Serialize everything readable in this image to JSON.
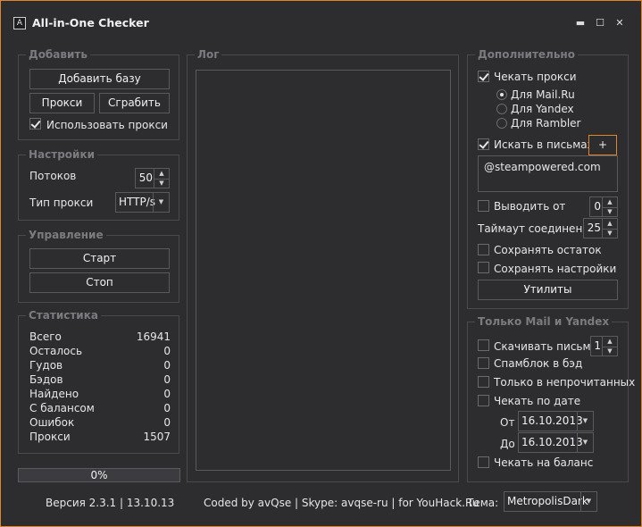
{
  "app": {
    "icon_letter": "A",
    "title": "All-in-One Checker"
  },
  "window_controls": {
    "minimize": "▬",
    "maximize": "☐",
    "close": "✕"
  },
  "add_group": {
    "title": "Добавить",
    "add_base": "Добавить базу",
    "proxy": "Прокси",
    "grab": "Сграбить",
    "use_proxy": {
      "label": "Использовать прокси",
      "checked": true
    }
  },
  "settings_group": {
    "title": "Настройки",
    "threads_label": "Потоков",
    "threads_value": "50",
    "proxy_type_label": "Тип прокси",
    "proxy_type_value": "HTTP/s"
  },
  "control_group": {
    "title": "Управление",
    "start": "Старт",
    "stop": "Стоп"
  },
  "stats_group": {
    "title": "Статистика",
    "rows": [
      {
        "label": "Всего",
        "value": "16941"
      },
      {
        "label": "Осталось",
        "value": "0"
      },
      {
        "label": "Гудов",
        "value": "0"
      },
      {
        "label": "Бэдов",
        "value": "0"
      },
      {
        "label": "Найдено",
        "value": "0"
      },
      {
        "label": "С балансом",
        "value": "0"
      },
      {
        "label": "Ошибок",
        "value": "0"
      },
      {
        "label": "Прокси",
        "value": "1507"
      }
    ]
  },
  "progress": {
    "text": "0%",
    "fraction": 0
  },
  "log_group": {
    "title": "Лог"
  },
  "extra_group": {
    "title": "Дополнительно",
    "check_proxy": {
      "label": "Чекать прокси",
      "checked": true
    },
    "radios": [
      {
        "label": "Для Mail.Ru",
        "selected": true
      },
      {
        "label": "Для Yandex",
        "selected": false
      },
      {
        "label": "Для Rambler",
        "selected": false
      }
    ],
    "search_in_letters": {
      "label": "Искать в письмах",
      "checked": true
    },
    "plus_button": "+",
    "search_text": "@steampowered.com",
    "output_from": {
      "label": "Выводить от",
      "checked": false,
      "value": "0"
    },
    "timeout_label": "Таймаут соединения",
    "timeout_value": "25",
    "save_rest": {
      "label": "Сохранять остаток",
      "checked": false
    },
    "save_settings": {
      "label": "Сохранять настройки",
      "checked": false
    },
    "utilities": "Утилиты"
  },
  "mailyandex_group": {
    "title": "Только Mail и Yandex",
    "download_letters": {
      "label": "Скачивать письма",
      "checked": false,
      "value": "1"
    },
    "spamblock": {
      "label": "Спамблок в бэд",
      "checked": false
    },
    "unread_only": {
      "label": "Только в непрочитанных",
      "checked": false
    },
    "check_by_date": {
      "label": "Чекать по дате",
      "checked": false
    },
    "from_label": "От",
    "from_date": "16.10.2013",
    "to_label": "До",
    "to_date": "16.10.2013",
    "check_balance": {
      "label": "Чекать на баланс",
      "checked": false
    }
  },
  "footer": {
    "version": "Версия 2.3.1 | 13.10.13",
    "credits": "Coded by avQse | Skype: avqse-ru | for YouHack.Ru",
    "theme_label": "Тема:",
    "theme_value": "MetropolisDark"
  },
  "colors": {
    "accent": "#e0852a",
    "background": "#2d2d30",
    "border": "#5a5a5e",
    "group_title": "#7b7b80"
  },
  "icons": {
    "spin_up": "▲",
    "spin_down": "▼",
    "dropdown": "▼"
  }
}
